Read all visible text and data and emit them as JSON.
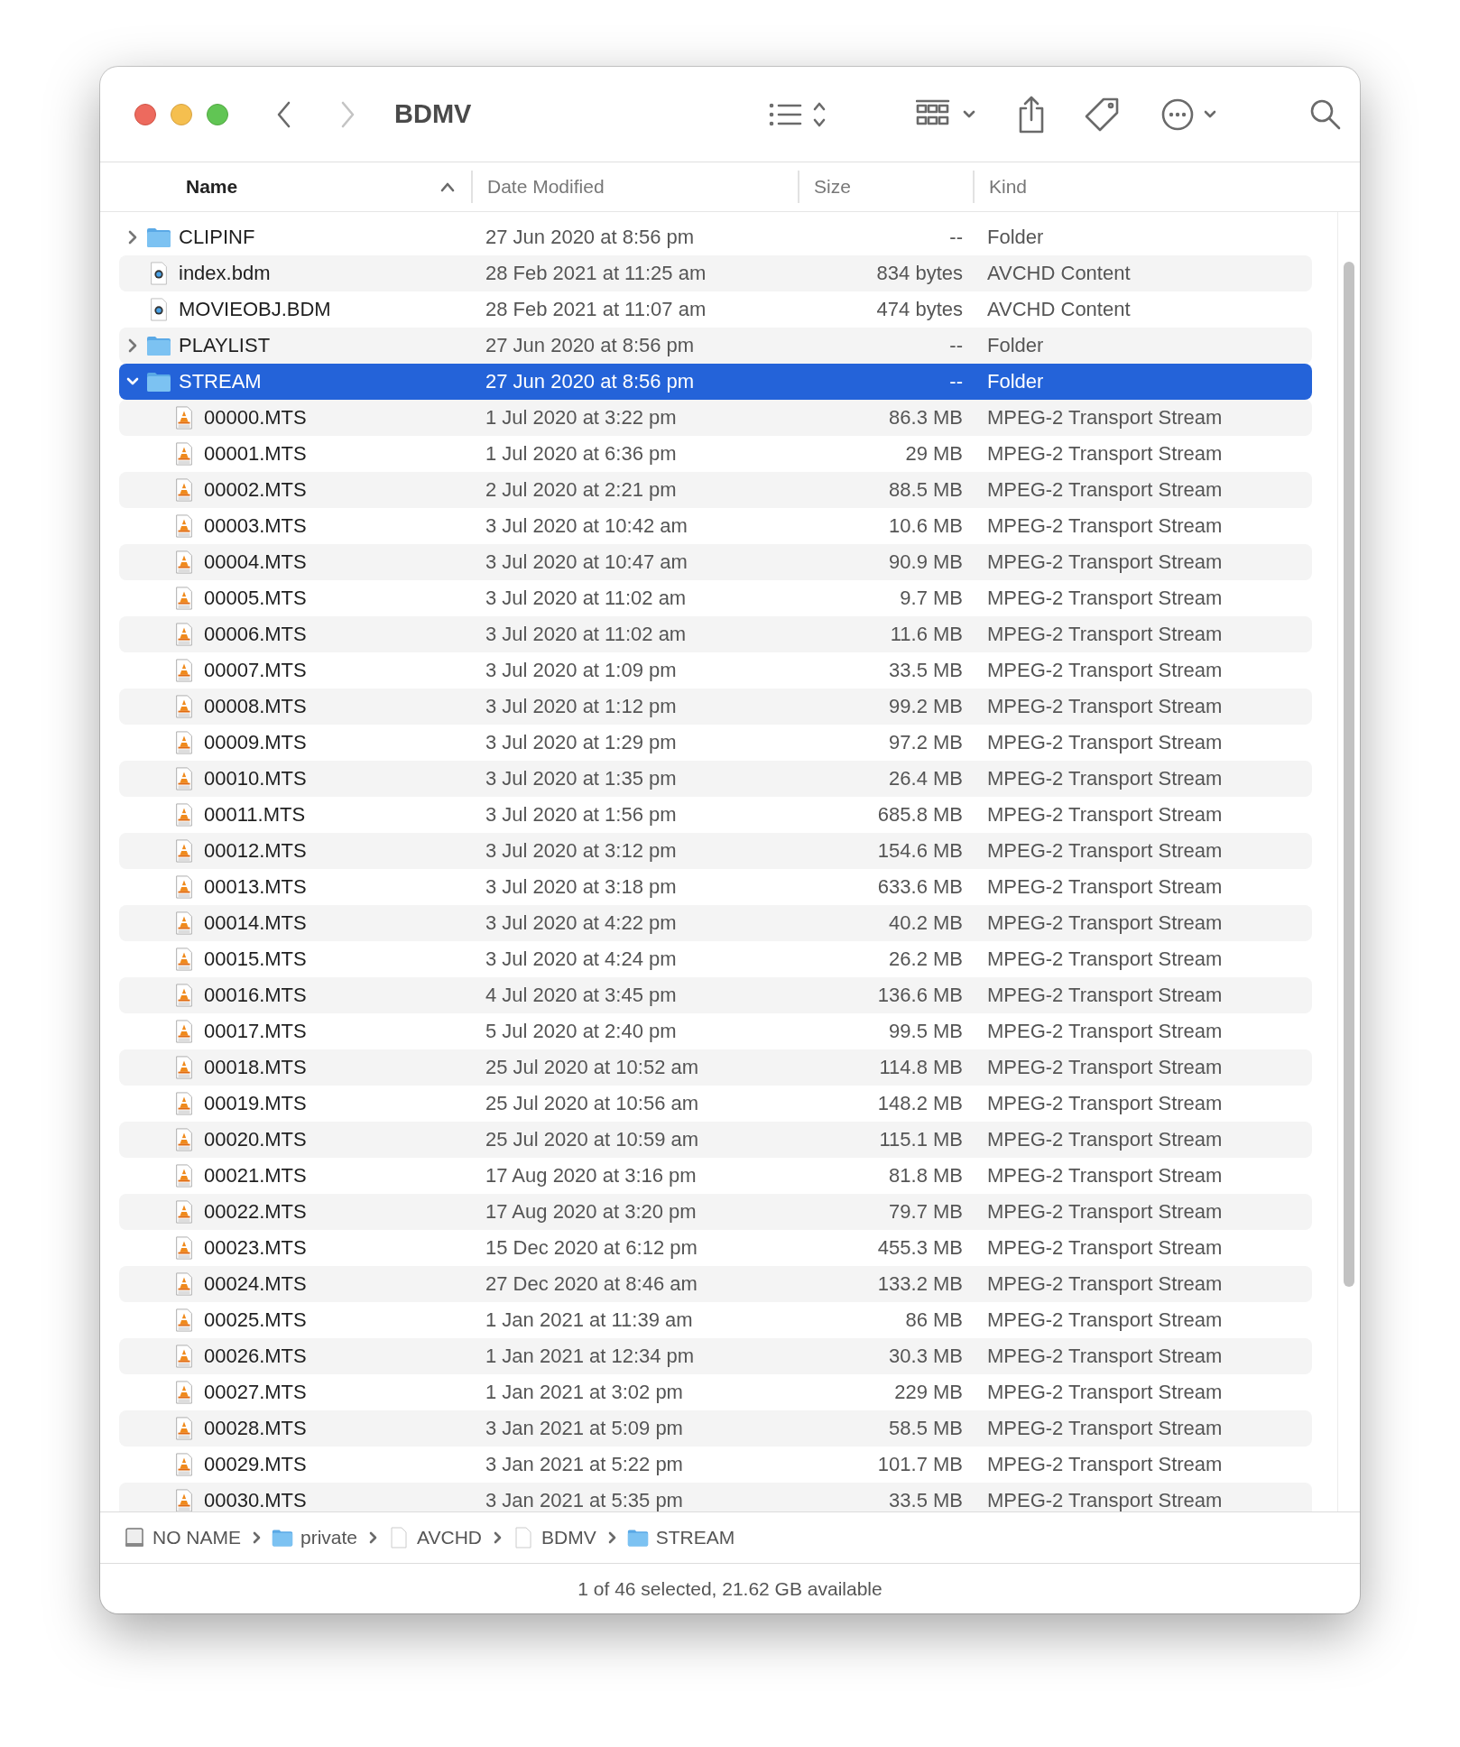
{
  "window": {
    "title": "BDMV"
  },
  "nav": {
    "back_disabled": false,
    "forward_disabled": true
  },
  "columns": [
    {
      "label": "Name",
      "sorted": true
    },
    {
      "label": "Date Modified",
      "sorted": false
    },
    {
      "label": "Size",
      "sorted": false
    },
    {
      "label": "Kind",
      "sorted": false
    }
  ],
  "rows": [
    {
      "kind": "folder",
      "name": "CLIPINF",
      "date": "27 Jun 2020 at 8:56 pm",
      "size": "--",
      "type": "Folder",
      "expanded": false,
      "selected": false
    },
    {
      "kind": "bdm",
      "name": "index.bdm",
      "date": "28 Feb 2021 at 11:25 am",
      "size": "834 bytes",
      "type": "AVCHD Content",
      "selected": false
    },
    {
      "kind": "bdm",
      "name": "MOVIEOBJ.BDM",
      "date": "28 Feb 2021 at 11:07 am",
      "size": "474 bytes",
      "type": "AVCHD Content",
      "selected": false
    },
    {
      "kind": "folder",
      "name": "PLAYLIST",
      "date": "27 Jun 2020 at 8:56 pm",
      "size": "--",
      "type": "Folder",
      "expanded": false,
      "selected": false
    },
    {
      "kind": "folder",
      "name": "STREAM",
      "date": "27 Jun 2020 at 8:56 pm",
      "size": "--",
      "type": "Folder",
      "expanded": true,
      "selected": true,
      "children": [
        {
          "kind": "mts",
          "name": "00000.MTS",
          "date": "1 Jul 2020 at 3:22 pm",
          "size": "86.3 MB",
          "type": "MPEG-2 Transport Stream",
          "selected": false
        },
        {
          "kind": "mts",
          "name": "00001.MTS",
          "date": "1 Jul 2020 at 6:36 pm",
          "size": "29 MB",
          "type": "MPEG-2 Transport Stream",
          "selected": false
        },
        {
          "kind": "mts",
          "name": "00002.MTS",
          "date": "2 Jul 2020 at 2:21 pm",
          "size": "88.5 MB",
          "type": "MPEG-2 Transport Stream",
          "selected": false
        },
        {
          "kind": "mts",
          "name": "00003.MTS",
          "date": "3 Jul 2020 at 10:42 am",
          "size": "10.6 MB",
          "type": "MPEG-2 Transport Stream",
          "selected": false
        },
        {
          "kind": "mts",
          "name": "00004.MTS",
          "date": "3 Jul 2020 at 10:47 am",
          "size": "90.9 MB",
          "type": "MPEG-2 Transport Stream",
          "selected": false
        },
        {
          "kind": "mts",
          "name": "00005.MTS",
          "date": "3 Jul 2020 at 11:02 am",
          "size": "9.7 MB",
          "type": "MPEG-2 Transport Stream",
          "selected": false
        },
        {
          "kind": "mts",
          "name": "00006.MTS",
          "date": "3 Jul 2020 at 11:02 am",
          "size": "11.6 MB",
          "type": "MPEG-2 Transport Stream",
          "selected": false
        },
        {
          "kind": "mts",
          "name": "00007.MTS",
          "date": "3 Jul 2020 at 1:09 pm",
          "size": "33.5 MB",
          "type": "MPEG-2 Transport Stream",
          "selected": false
        },
        {
          "kind": "mts",
          "name": "00008.MTS",
          "date": "3 Jul 2020 at 1:12 pm",
          "size": "99.2 MB",
          "type": "MPEG-2 Transport Stream",
          "selected": false
        },
        {
          "kind": "mts",
          "name": "00009.MTS",
          "date": "3 Jul 2020 at 1:29 pm",
          "size": "97.2 MB",
          "type": "MPEG-2 Transport Stream",
          "selected": false
        },
        {
          "kind": "mts",
          "name": "00010.MTS",
          "date": "3 Jul 2020 at 1:35 pm",
          "size": "26.4 MB",
          "type": "MPEG-2 Transport Stream",
          "selected": false
        },
        {
          "kind": "mts",
          "name": "00011.MTS",
          "date": "3 Jul 2020 at 1:56 pm",
          "size": "685.8 MB",
          "type": "MPEG-2 Transport Stream",
          "selected": false
        },
        {
          "kind": "mts",
          "name": "00012.MTS",
          "date": "3 Jul 2020 at 3:12 pm",
          "size": "154.6 MB",
          "type": "MPEG-2 Transport Stream",
          "selected": false
        },
        {
          "kind": "mts",
          "name": "00013.MTS",
          "date": "3 Jul 2020 at 3:18 pm",
          "size": "633.6 MB",
          "type": "MPEG-2 Transport Stream",
          "selected": false
        },
        {
          "kind": "mts",
          "name": "00014.MTS",
          "date": "3 Jul 2020 at 4:22 pm",
          "size": "40.2 MB",
          "type": "MPEG-2 Transport Stream",
          "selected": false
        },
        {
          "kind": "mts",
          "name": "00015.MTS",
          "date": "3 Jul 2020 at 4:24 pm",
          "size": "26.2 MB",
          "type": "MPEG-2 Transport Stream",
          "selected": false
        },
        {
          "kind": "mts",
          "name": "00016.MTS",
          "date": "4 Jul 2020 at 3:45 pm",
          "size": "136.6 MB",
          "type": "MPEG-2 Transport Stream",
          "selected": false
        },
        {
          "kind": "mts",
          "name": "00017.MTS",
          "date": "5 Jul 2020 at 2:40 pm",
          "size": "99.5 MB",
          "type": "MPEG-2 Transport Stream",
          "selected": false
        },
        {
          "kind": "mts",
          "name": "00018.MTS",
          "date": "25 Jul 2020 at 10:52 am",
          "size": "114.8 MB",
          "type": "MPEG-2 Transport Stream",
          "selected": false
        },
        {
          "kind": "mts",
          "name": "00019.MTS",
          "date": "25 Jul 2020 at 10:56 am",
          "size": "148.2 MB",
          "type": "MPEG-2 Transport Stream",
          "selected": false
        },
        {
          "kind": "mts",
          "name": "00020.MTS",
          "date": "25 Jul 2020 at 10:59 am",
          "size": "115.1 MB",
          "type": "MPEG-2 Transport Stream",
          "selected": false
        },
        {
          "kind": "mts",
          "name": "00021.MTS",
          "date": "17 Aug 2020 at 3:16 pm",
          "size": "81.8 MB",
          "type": "MPEG-2 Transport Stream",
          "selected": false
        },
        {
          "kind": "mts",
          "name": "00022.MTS",
          "date": "17 Aug 2020 at 3:20 pm",
          "size": "79.7 MB",
          "type": "MPEG-2 Transport Stream",
          "selected": false
        },
        {
          "kind": "mts",
          "name": "00023.MTS",
          "date": "15 Dec 2020 at 6:12 pm",
          "size": "455.3 MB",
          "type": "MPEG-2 Transport Stream",
          "selected": false
        },
        {
          "kind": "mts",
          "name": "00024.MTS",
          "date": "27 Dec 2020 at 8:46 am",
          "size": "133.2 MB",
          "type": "MPEG-2 Transport Stream",
          "selected": false
        },
        {
          "kind": "mts",
          "name": "00025.MTS",
          "date": "1 Jan 2021 at 11:39 am",
          "size": "86 MB",
          "type": "MPEG-2 Transport Stream",
          "selected": false
        },
        {
          "kind": "mts",
          "name": "00026.MTS",
          "date": "1 Jan 2021 at 12:34 pm",
          "size": "30.3 MB",
          "type": "MPEG-2 Transport Stream",
          "selected": false
        },
        {
          "kind": "mts",
          "name": "00027.MTS",
          "date": "1 Jan 2021 at 3:02 pm",
          "size": "229 MB",
          "type": "MPEG-2 Transport Stream",
          "selected": false
        },
        {
          "kind": "mts",
          "name": "00028.MTS",
          "date": "3 Jan 2021 at 5:09 pm",
          "size": "58.5 MB",
          "type": "MPEG-2 Transport Stream",
          "selected": false
        },
        {
          "kind": "mts",
          "name": "00029.MTS",
          "date": "3 Jan 2021 at 5:22 pm",
          "size": "101.7 MB",
          "type": "MPEG-2 Transport Stream",
          "selected": false
        },
        {
          "kind": "mts",
          "name": "00030.MTS",
          "date": "3 Jan 2021 at 5:35 pm",
          "size": "33.5 MB",
          "type": "MPEG-2 Transport Stream",
          "selected": false
        }
      ]
    }
  ],
  "path_bar": [
    {
      "kind": "disk",
      "label": "NO NAME"
    },
    {
      "kind": "folder",
      "label": "private"
    },
    {
      "kind": "doc",
      "label": "AVCHD"
    },
    {
      "kind": "doc",
      "label": "BDMV"
    },
    {
      "kind": "folder",
      "label": "STREAM"
    }
  ],
  "status_bar": "1 of 46 selected, 21.62 GB available"
}
